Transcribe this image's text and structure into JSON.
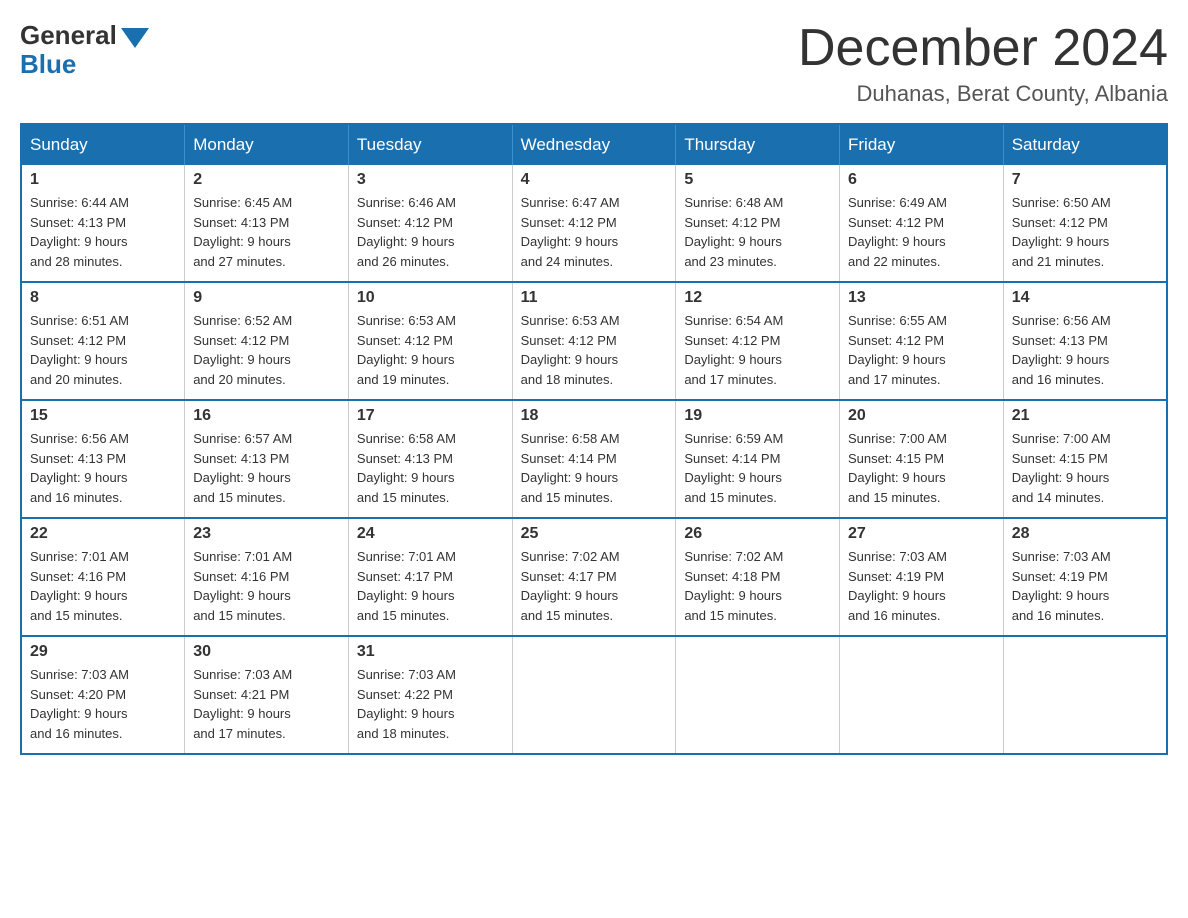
{
  "logo": {
    "general": "General",
    "blue": "Blue"
  },
  "header": {
    "month": "December 2024",
    "location": "Duhanas, Berat County, Albania"
  },
  "weekdays": [
    "Sunday",
    "Monday",
    "Tuesday",
    "Wednesday",
    "Thursday",
    "Friday",
    "Saturday"
  ],
  "weeks": [
    [
      {
        "day": "1",
        "sunrise": "6:44 AM",
        "sunset": "4:13 PM",
        "daylight": "9 hours and 28 minutes."
      },
      {
        "day": "2",
        "sunrise": "6:45 AM",
        "sunset": "4:13 PM",
        "daylight": "9 hours and 27 minutes."
      },
      {
        "day": "3",
        "sunrise": "6:46 AM",
        "sunset": "4:12 PM",
        "daylight": "9 hours and 26 minutes."
      },
      {
        "day": "4",
        "sunrise": "6:47 AM",
        "sunset": "4:12 PM",
        "daylight": "9 hours and 24 minutes."
      },
      {
        "day": "5",
        "sunrise": "6:48 AM",
        "sunset": "4:12 PM",
        "daylight": "9 hours and 23 minutes."
      },
      {
        "day": "6",
        "sunrise": "6:49 AM",
        "sunset": "4:12 PM",
        "daylight": "9 hours and 22 minutes."
      },
      {
        "day": "7",
        "sunrise": "6:50 AM",
        "sunset": "4:12 PM",
        "daylight": "9 hours and 21 minutes."
      }
    ],
    [
      {
        "day": "8",
        "sunrise": "6:51 AM",
        "sunset": "4:12 PM",
        "daylight": "9 hours and 20 minutes."
      },
      {
        "day": "9",
        "sunrise": "6:52 AM",
        "sunset": "4:12 PM",
        "daylight": "9 hours and 20 minutes."
      },
      {
        "day": "10",
        "sunrise": "6:53 AM",
        "sunset": "4:12 PM",
        "daylight": "9 hours and 19 minutes."
      },
      {
        "day": "11",
        "sunrise": "6:53 AM",
        "sunset": "4:12 PM",
        "daylight": "9 hours and 18 minutes."
      },
      {
        "day": "12",
        "sunrise": "6:54 AM",
        "sunset": "4:12 PM",
        "daylight": "9 hours and 17 minutes."
      },
      {
        "day": "13",
        "sunrise": "6:55 AM",
        "sunset": "4:12 PM",
        "daylight": "9 hours and 17 minutes."
      },
      {
        "day": "14",
        "sunrise": "6:56 AM",
        "sunset": "4:13 PM",
        "daylight": "9 hours and 16 minutes."
      }
    ],
    [
      {
        "day": "15",
        "sunrise": "6:56 AM",
        "sunset": "4:13 PM",
        "daylight": "9 hours and 16 minutes."
      },
      {
        "day": "16",
        "sunrise": "6:57 AM",
        "sunset": "4:13 PM",
        "daylight": "9 hours and 15 minutes."
      },
      {
        "day": "17",
        "sunrise": "6:58 AM",
        "sunset": "4:13 PM",
        "daylight": "9 hours and 15 minutes."
      },
      {
        "day": "18",
        "sunrise": "6:58 AM",
        "sunset": "4:14 PM",
        "daylight": "9 hours and 15 minutes."
      },
      {
        "day": "19",
        "sunrise": "6:59 AM",
        "sunset": "4:14 PM",
        "daylight": "9 hours and 15 minutes."
      },
      {
        "day": "20",
        "sunrise": "7:00 AM",
        "sunset": "4:15 PM",
        "daylight": "9 hours and 15 minutes."
      },
      {
        "day": "21",
        "sunrise": "7:00 AM",
        "sunset": "4:15 PM",
        "daylight": "9 hours and 14 minutes."
      }
    ],
    [
      {
        "day": "22",
        "sunrise": "7:01 AM",
        "sunset": "4:16 PM",
        "daylight": "9 hours and 15 minutes."
      },
      {
        "day": "23",
        "sunrise": "7:01 AM",
        "sunset": "4:16 PM",
        "daylight": "9 hours and 15 minutes."
      },
      {
        "day": "24",
        "sunrise": "7:01 AM",
        "sunset": "4:17 PM",
        "daylight": "9 hours and 15 minutes."
      },
      {
        "day": "25",
        "sunrise": "7:02 AM",
        "sunset": "4:17 PM",
        "daylight": "9 hours and 15 minutes."
      },
      {
        "day": "26",
        "sunrise": "7:02 AM",
        "sunset": "4:18 PM",
        "daylight": "9 hours and 15 minutes."
      },
      {
        "day": "27",
        "sunrise": "7:03 AM",
        "sunset": "4:19 PM",
        "daylight": "9 hours and 16 minutes."
      },
      {
        "day": "28",
        "sunrise": "7:03 AM",
        "sunset": "4:19 PM",
        "daylight": "9 hours and 16 minutes."
      }
    ],
    [
      {
        "day": "29",
        "sunrise": "7:03 AM",
        "sunset": "4:20 PM",
        "daylight": "9 hours and 16 minutes."
      },
      {
        "day": "30",
        "sunrise": "7:03 AM",
        "sunset": "4:21 PM",
        "daylight": "9 hours and 17 minutes."
      },
      {
        "day": "31",
        "sunrise": "7:03 AM",
        "sunset": "4:22 PM",
        "daylight": "9 hours and 18 minutes."
      },
      null,
      null,
      null,
      null
    ]
  ],
  "labels": {
    "sunrise": "Sunrise:",
    "sunset": "Sunset:",
    "daylight": "Daylight:"
  }
}
